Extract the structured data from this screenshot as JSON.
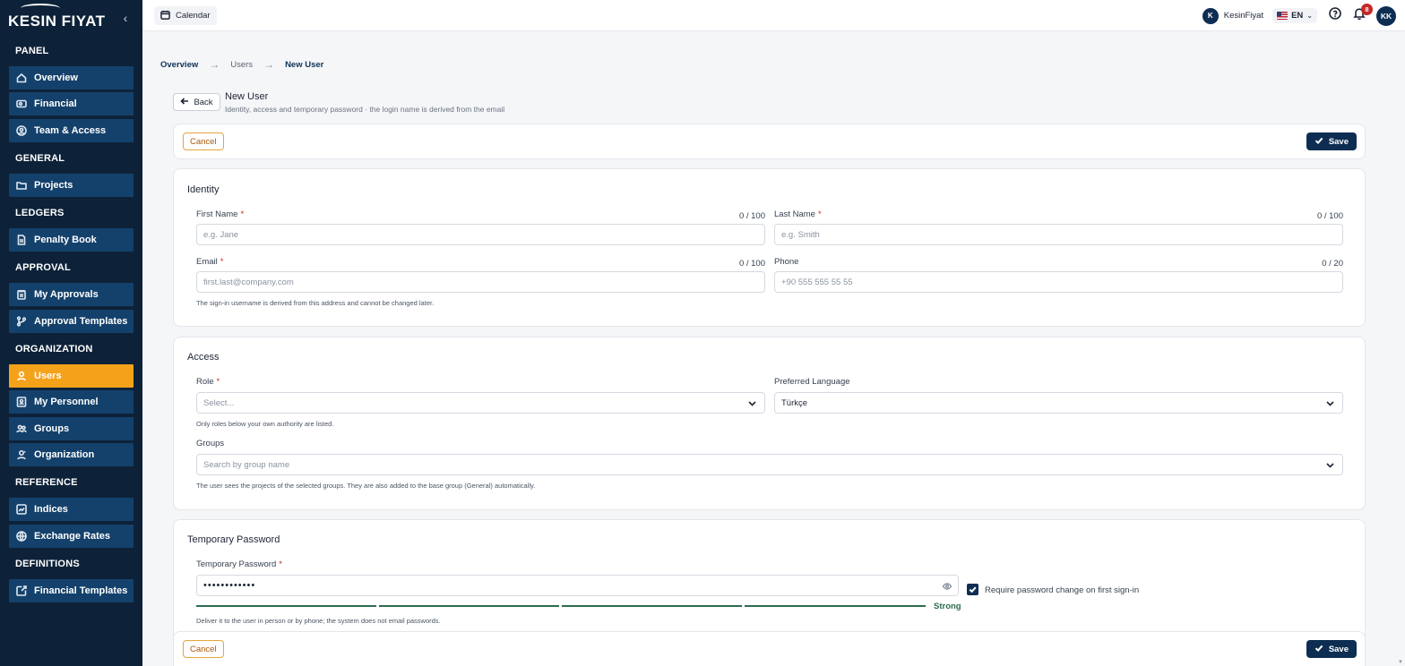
{
  "brand": {
    "name": "KESIN FIYAT"
  },
  "sidebar": {
    "sections": [
      {
        "title": "PANEL",
        "items": [
          {
            "label": "Overview",
            "icon": "home-icon"
          },
          {
            "label": "Financial",
            "icon": "wallet-icon"
          },
          {
            "label": "Team & Access",
            "icon": "user-badge-icon"
          }
        ]
      },
      {
        "title": "GENERAL",
        "items": [
          {
            "label": "Projects",
            "icon": "folder-icon"
          }
        ]
      },
      {
        "title": "LEDGERS",
        "items": [
          {
            "label": "Penalty Book",
            "icon": "document-icon"
          }
        ]
      },
      {
        "title": "APPROVAL",
        "items": [
          {
            "label": "My Approvals",
            "icon": "clipboard-icon"
          },
          {
            "label": "Approval Templates",
            "icon": "git-branch-icon"
          }
        ]
      },
      {
        "title": "ORGANIZATION",
        "items": [
          {
            "label": "Users",
            "icon": "user-icon",
            "active": true
          },
          {
            "label": "My Personnel",
            "icon": "id-card-icon"
          },
          {
            "label": "Groups",
            "icon": "group-icon"
          },
          {
            "label": "Organization",
            "icon": "organization-icon"
          }
        ]
      },
      {
        "title": "REFERENCE",
        "items": [
          {
            "label": "Indices",
            "icon": "trend-icon"
          },
          {
            "label": "Exchange Rates",
            "icon": "globe-icon"
          }
        ]
      },
      {
        "title": "DEFINITIONS",
        "items": [
          {
            "label": "Financial Templates",
            "icon": "external-icon"
          }
        ]
      }
    ]
  },
  "topbar": {
    "calendar_label": "Calendar",
    "org_initial": "K",
    "org_name": "KesinFiyat",
    "language": "EN",
    "notification_count": "8",
    "user_initials": "KK"
  },
  "breadcrumb": [
    "Overview",
    "Users",
    "New User"
  ],
  "header": {
    "back_label": "Back",
    "title": "New User",
    "subtitle": "Identity, access and temporary password · the login name is derived from the email"
  },
  "actions": {
    "cancel_label": "Cancel",
    "save_label": "Save"
  },
  "identity": {
    "title": "Identity",
    "first_name": {
      "label": "First Name",
      "placeholder": "e.g. Jane",
      "counter": "0 / 100"
    },
    "last_name": {
      "label": "Last Name",
      "placeholder": "e.g. Smith",
      "counter": "0 / 100"
    },
    "email": {
      "label": "Email",
      "placeholder": "first.last@company.com",
      "counter": "0 / 100",
      "hint": "The sign-in username is derived from this address and cannot be changed later."
    },
    "phone": {
      "label": "Phone",
      "placeholder": "+90 555 555 55 55",
      "counter": "0 / 20"
    }
  },
  "access": {
    "title": "Access",
    "role": {
      "label": "Role",
      "placeholder": "Select...",
      "hint": "Only roles below your own authority are listed."
    },
    "language": {
      "label": "Preferred Language",
      "value": "Türkçe"
    },
    "groups": {
      "label": "Groups",
      "placeholder": "Search by group name",
      "hint": "The user sees the projects of the selected groups. They are also added to the base group (General) automatically."
    }
  },
  "password": {
    "title": "Temporary Password",
    "label": "Temporary Password",
    "masked_value": "••••••••••••",
    "strength": "Strong",
    "strength_level": 1.0,
    "require_change_label": "Require password change on first sign-in",
    "require_change": true,
    "hint": "Deliver it to the user in person or by phone; the system does not email passwords."
  },
  "colors": {
    "sidebar_bg": "#0d2238",
    "nav_item_bg": "#14416b",
    "active": "#f5a21b",
    "primary": "#0d2e52",
    "strength": "#2e6b4f"
  }
}
